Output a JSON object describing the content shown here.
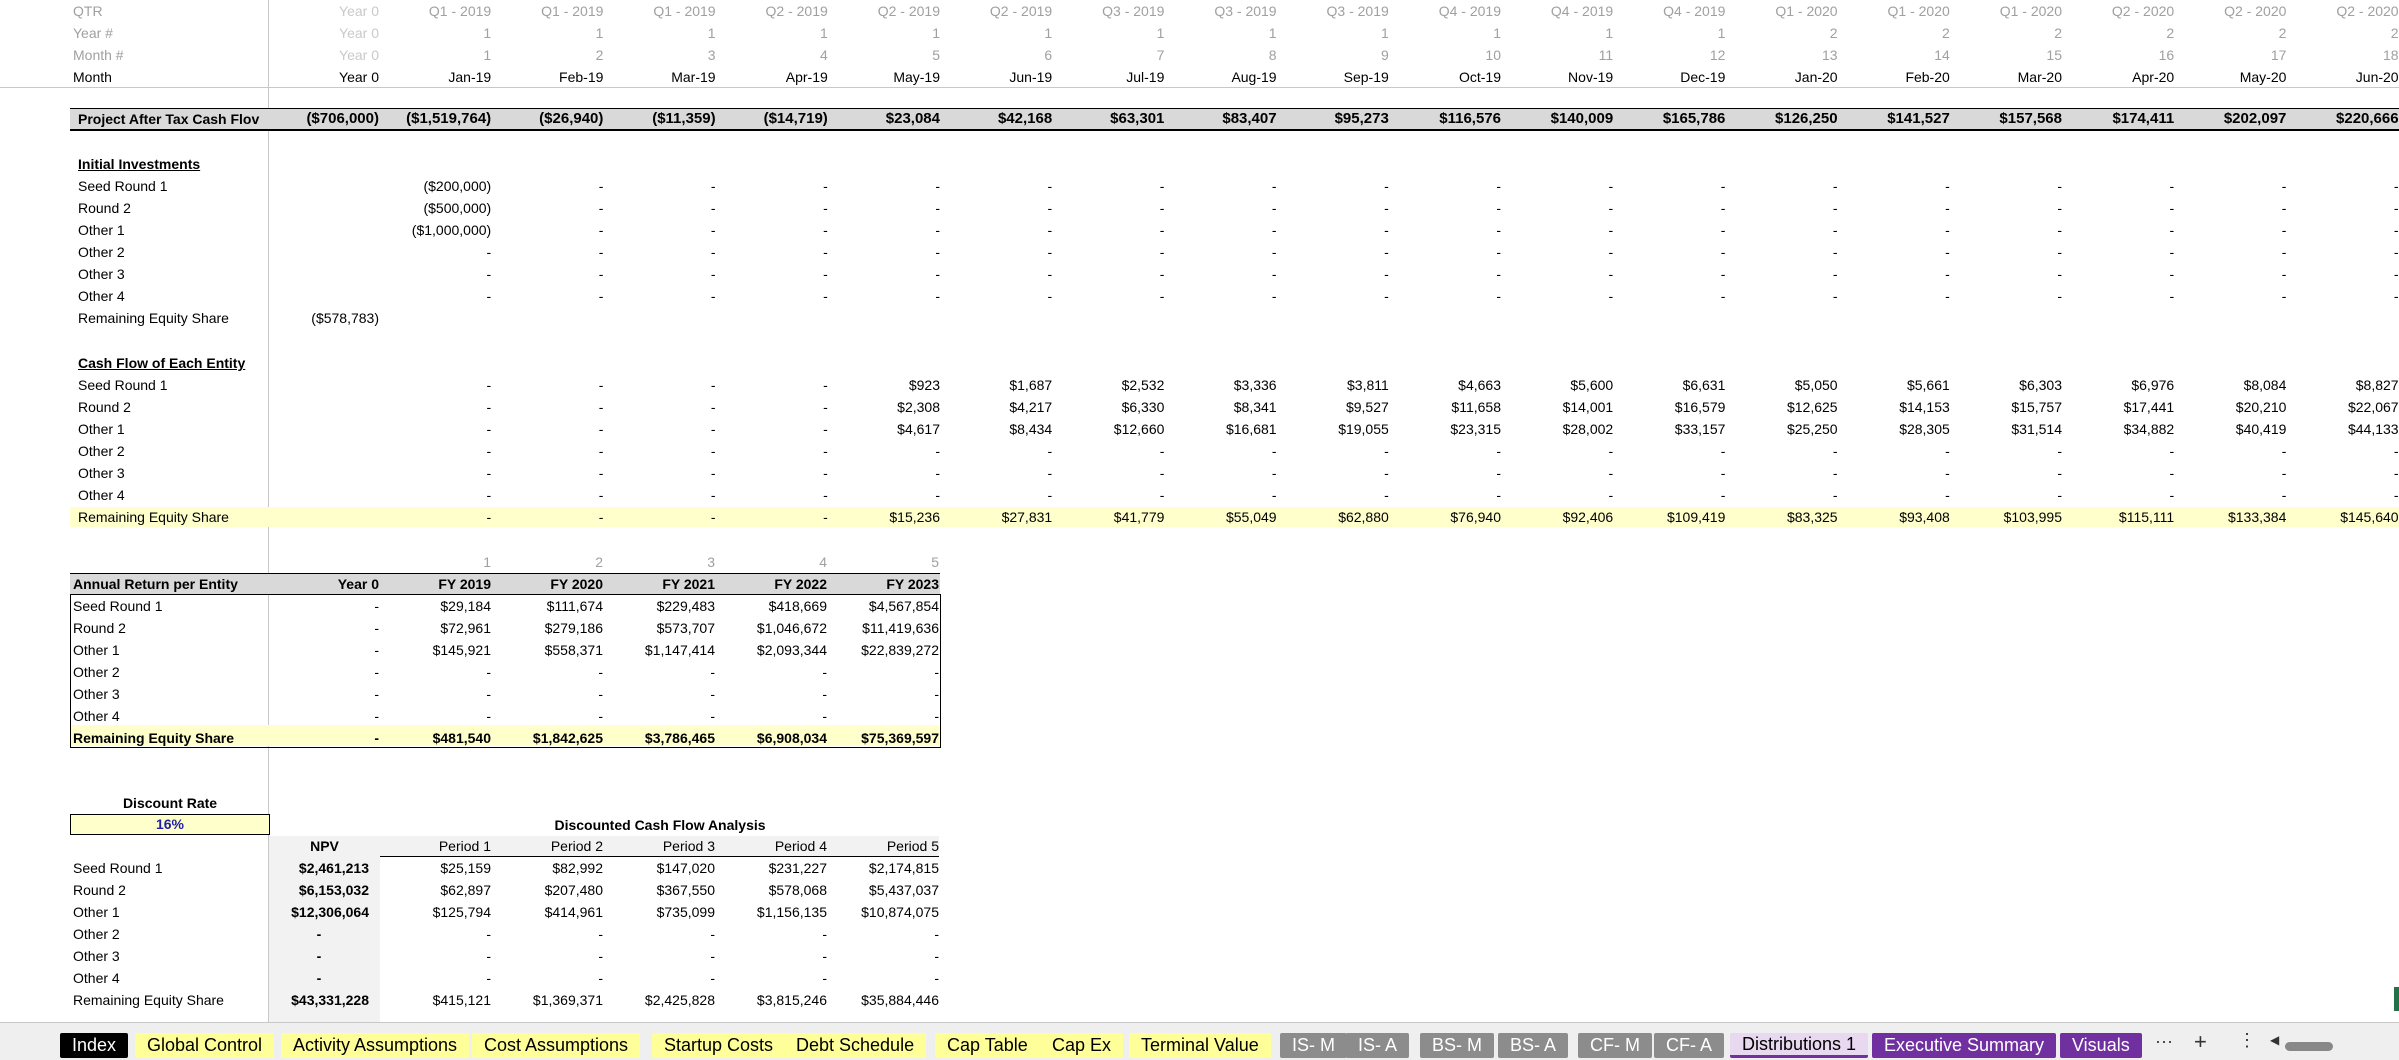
{
  "header_rows": {
    "qtr_label": "QTR",
    "year_label": "Year #",
    "month_num_label": "Month #",
    "month_label": "Month",
    "columns": [
      {
        "qtr": "Year 0",
        "year": "Year 0",
        "mnum": "Year 0",
        "month": "Year 0"
      },
      {
        "qtr": "Q1 - 2019",
        "year": "1",
        "mnum": "1",
        "month": "Jan-19"
      },
      {
        "qtr": "Q1 - 2019",
        "year": "1",
        "mnum": "2",
        "month": "Feb-19"
      },
      {
        "qtr": "Q1 - 2019",
        "year": "1",
        "mnum": "3",
        "month": "Mar-19"
      },
      {
        "qtr": "Q2 - 2019",
        "year": "1",
        "mnum": "4",
        "month": "Apr-19"
      },
      {
        "qtr": "Q2 - 2019",
        "year": "1",
        "mnum": "5",
        "month": "May-19"
      },
      {
        "qtr": "Q2 - 2019",
        "year": "1",
        "mnum": "6",
        "month": "Jun-19"
      },
      {
        "qtr": "Q3 - 2019",
        "year": "1",
        "mnum": "7",
        "month": "Jul-19"
      },
      {
        "qtr": "Q3 - 2019",
        "year": "1",
        "mnum": "8",
        "month": "Aug-19"
      },
      {
        "qtr": "Q3 - 2019",
        "year": "1",
        "mnum": "9",
        "month": "Sep-19"
      },
      {
        "qtr": "Q4 - 2019",
        "year": "1",
        "mnum": "10",
        "month": "Oct-19"
      },
      {
        "qtr": "Q4 - 2019",
        "year": "1",
        "mnum": "11",
        "month": "Nov-19"
      },
      {
        "qtr": "Q4 - 2019",
        "year": "1",
        "mnum": "12",
        "month": "Dec-19"
      },
      {
        "qtr": "Q1 - 2020",
        "year": "2",
        "mnum": "13",
        "month": "Jan-20"
      },
      {
        "qtr": "Q1 - 2020",
        "year": "2",
        "mnum": "14",
        "month": "Feb-20"
      },
      {
        "qtr": "Q1 - 2020",
        "year": "2",
        "mnum": "15",
        "month": "Mar-20"
      },
      {
        "qtr": "Q2 - 2020",
        "year": "2",
        "mnum": "16",
        "month": "Apr-20"
      },
      {
        "qtr": "Q2 - 2020",
        "year": "2",
        "mnum": "17",
        "month": "May-20"
      },
      {
        "qtr": "Q2 - 2020",
        "year": "2",
        "mnum": "18",
        "month": "Jun-20"
      }
    ]
  },
  "project_cash_flow": {
    "label": "Project After Tax Cash Flov",
    "values": [
      "($706,000)",
      "($1,519,764)",
      "($26,940)",
      "($11,359)",
      "($14,719)",
      "$23,084",
      "$42,168",
      "$63,301",
      "$83,407",
      "$95,273",
      "$116,576",
      "$140,009",
      "$165,786",
      "$126,250",
      "$141,527",
      "$157,568",
      "$174,411",
      "$202,097",
      "$220,666"
    ]
  },
  "initial_investments": {
    "title": "Initial Investments",
    "rows": [
      {
        "label": "Seed Round 1",
        "values": [
          "",
          "($200,000)",
          "-",
          "-",
          "-",
          "-",
          "-",
          "-",
          "-",
          "-",
          "-",
          "-",
          "-",
          "-",
          "-",
          "-",
          "-",
          "-",
          "-"
        ]
      },
      {
        "label": "Round 2",
        "values": [
          "",
          "($500,000)",
          "-",
          "-",
          "-",
          "-",
          "-",
          "-",
          "-",
          "-",
          "-",
          "-",
          "-",
          "-",
          "-",
          "-",
          "-",
          "-",
          "-"
        ]
      },
      {
        "label": "Other 1",
        "values": [
          "",
          "($1,000,000)",
          "-",
          "-",
          "-",
          "-",
          "-",
          "-",
          "-",
          "-",
          "-",
          "-",
          "-",
          "-",
          "-",
          "-",
          "-",
          "-",
          "-"
        ]
      },
      {
        "label": "Other 2",
        "values": [
          "",
          "-",
          "-",
          "-",
          "-",
          "-",
          "-",
          "-",
          "-",
          "-",
          "-",
          "-",
          "-",
          "-",
          "-",
          "-",
          "-",
          "-",
          "-"
        ]
      },
      {
        "label": "Other 3",
        "values": [
          "",
          "-",
          "-",
          "-",
          "-",
          "-",
          "-",
          "-",
          "-",
          "-",
          "-",
          "-",
          "-",
          "-",
          "-",
          "-",
          "-",
          "-",
          "-"
        ]
      },
      {
        "label": "Other 4",
        "values": [
          "",
          "-",
          "-",
          "-",
          "-",
          "-",
          "-",
          "-",
          "-",
          "-",
          "-",
          "-",
          "-",
          "-",
          "-",
          "-",
          "-",
          "-",
          "-"
        ]
      },
      {
        "label": "Remaining Equity Share",
        "values": [
          "($578,783)",
          "",
          "",
          "",
          "",
          "",
          "",
          "",
          "",
          "",
          "",
          "",
          "",
          "",
          "",
          "",
          "",
          "",
          ""
        ]
      }
    ]
  },
  "entity_cash_flow": {
    "title": "Cash Flow of Each Entity",
    "rows": [
      {
        "label": "Seed Round 1",
        "values": [
          "",
          "-",
          "-",
          "-",
          "-",
          "$923",
          "$1,687",
          "$2,532",
          "$3,336",
          "$3,811",
          "$4,663",
          "$5,600",
          "$6,631",
          "$5,050",
          "$5,661",
          "$6,303",
          "$6,976",
          "$8,084",
          "$8,827"
        ]
      },
      {
        "label": "Round 2",
        "values": [
          "",
          "-",
          "-",
          "-",
          "-",
          "$2,308",
          "$4,217",
          "$6,330",
          "$8,341",
          "$9,527",
          "$11,658",
          "$14,001",
          "$16,579",
          "$12,625",
          "$14,153",
          "$15,757",
          "$17,441",
          "$20,210",
          "$22,067"
        ]
      },
      {
        "label": "Other 1",
        "values": [
          "",
          "-",
          "-",
          "-",
          "-",
          "$4,617",
          "$8,434",
          "$12,660",
          "$16,681",
          "$19,055",
          "$23,315",
          "$28,002",
          "$33,157",
          "$25,250",
          "$28,305",
          "$31,514",
          "$34,882",
          "$40,419",
          "$44,133"
        ]
      },
      {
        "label": "Other 2",
        "values": [
          "",
          "-",
          "-",
          "-",
          "-",
          "-",
          "-",
          "-",
          "-",
          "-",
          "-",
          "-",
          "-",
          "-",
          "-",
          "-",
          "-",
          "-",
          "-"
        ]
      },
      {
        "label": "Other 3",
        "values": [
          "",
          "-",
          "-",
          "-",
          "-",
          "-",
          "-",
          "-",
          "-",
          "-",
          "-",
          "-",
          "-",
          "-",
          "-",
          "-",
          "-",
          "-",
          "-"
        ]
      },
      {
        "label": "Other 4",
        "values": [
          "",
          "-",
          "-",
          "-",
          "-",
          "-",
          "-",
          "-",
          "-",
          "-",
          "-",
          "-",
          "-",
          "-",
          "-",
          "-",
          "-",
          "-",
          "-"
        ]
      },
      {
        "label": "Remaining Equity Share",
        "values": [
          "",
          "-",
          "-",
          "-",
          "-",
          "$15,236",
          "$27,831",
          "$41,779",
          "$55,049",
          "$62,880",
          "$76,940",
          "$92,406",
          "$109,419",
          "$83,325",
          "$93,408",
          "$103,995",
          "$115,111",
          "$133,384",
          "$145,640"
        ]
      }
    ]
  },
  "annual_return": {
    "year_nums": [
      "1",
      "2",
      "3",
      "4",
      "5"
    ],
    "title": "Annual Return per Entity",
    "headers": [
      "Year 0",
      "FY 2019",
      "FY 2020",
      "FY 2021",
      "FY 2022",
      "FY 2023"
    ],
    "rows": [
      {
        "label": "Seed Round 1",
        "values": [
          "-",
          "$29,184",
          "$111,674",
          "$229,483",
          "$418,669",
          "$4,567,854"
        ]
      },
      {
        "label": "Round 2",
        "values": [
          "-",
          "$72,961",
          "$279,186",
          "$573,707",
          "$1,046,672",
          "$11,419,636"
        ]
      },
      {
        "label": "Other 1",
        "values": [
          "-",
          "$145,921",
          "$558,371",
          "$1,147,414",
          "$2,093,344",
          "$22,839,272"
        ]
      },
      {
        "label": "Other 2",
        "values": [
          "-",
          "-",
          "-",
          "-",
          "-",
          "-"
        ]
      },
      {
        "label": "Other 3",
        "values": [
          "-",
          "-",
          "-",
          "-",
          "-",
          "-"
        ]
      },
      {
        "label": "Other 4",
        "values": [
          "-",
          "-",
          "-",
          "-",
          "-",
          "-"
        ]
      },
      {
        "label": "Remaining Equity Share",
        "values": [
          "-",
          "$481,540",
          "$1,842,625",
          "$3,786,465",
          "$6,908,034",
          "$75,369,597"
        ]
      }
    ]
  },
  "discount": {
    "label": "Discount Rate",
    "value": "16%"
  },
  "dcf": {
    "title": "Discounted Cash Flow Analysis",
    "headers": [
      "NPV",
      "Period 1",
      "Period 2",
      "Period 3",
      "Period 4",
      "Period 5"
    ],
    "rows": [
      {
        "label": "Seed Round 1",
        "values": [
          "$2,461,213",
          "$25,159",
          "$82,992",
          "$147,020",
          "$231,227",
          "$2,174,815"
        ]
      },
      {
        "label": "Round 2",
        "values": [
          "$6,153,032",
          "$62,897",
          "$207,480",
          "$367,550",
          "$578,068",
          "$5,437,037"
        ]
      },
      {
        "label": "Other 1",
        "values": [
          "$12,306,064",
          "$125,794",
          "$414,961",
          "$735,099",
          "$1,156,135",
          "$10,874,075"
        ]
      },
      {
        "label": "Other 2",
        "values": [
          "-",
          "-",
          "-",
          "-",
          "-",
          "-"
        ]
      },
      {
        "label": "Other 3",
        "values": [
          "-",
          "-",
          "-",
          "-",
          "-",
          "-"
        ]
      },
      {
        "label": "Other 4",
        "values": [
          "-",
          "-",
          "-",
          "-",
          "-",
          "-"
        ]
      },
      {
        "label": "Remaining Equity Share",
        "values": [
          "$43,331,228",
          "$415,121",
          "$1,369,371",
          "$2,425,828",
          "$3,815,246",
          "$35,884,446"
        ]
      }
    ]
  },
  "tabs": [
    {
      "label": "Index",
      "bg": "#000000",
      "fg": "#ffffff",
      "active": false
    },
    {
      "label": "Global Control",
      "bg": "#ffff99",
      "fg": "#000000",
      "active": false
    },
    {
      "label": "Activity Assumptions",
      "bg": "#ffff99",
      "fg": "#000000",
      "active": false
    },
    {
      "label": "Cost Assumptions",
      "bg": "#ffff99",
      "fg": "#000000",
      "active": false
    },
    {
      "label": "Startup Costs",
      "bg": "#ffff99",
      "fg": "#000000",
      "active": false
    },
    {
      "label": "Debt Schedule",
      "bg": "#ffff99",
      "fg": "#000000",
      "active": false
    },
    {
      "label": "Cap Table",
      "bg": "#ffff99",
      "fg": "#000000",
      "active": false
    },
    {
      "label": "Cap Ex",
      "bg": "#ffff99",
      "fg": "#000000",
      "active": false
    },
    {
      "label": "Terminal Value",
      "bg": "#ffff99",
      "fg": "#000000",
      "active": false
    },
    {
      "label": "IS- M",
      "bg": "#8c8c8c",
      "fg": "#ffffff",
      "active": false
    },
    {
      "label": "IS- A",
      "bg": "#8c8c8c",
      "fg": "#ffffff",
      "active": false
    },
    {
      "label": "BS- M",
      "bg": "#8c8c8c",
      "fg": "#ffffff",
      "active": false
    },
    {
      "label": "BS- A",
      "bg": "#8c8c8c",
      "fg": "#ffffff",
      "active": false
    },
    {
      "label": "CF- M",
      "bg": "#8c8c8c",
      "fg": "#ffffff",
      "active": false
    },
    {
      "label": "CF- A",
      "bg": "#8c8c8c",
      "fg": "#ffffff",
      "active": false
    },
    {
      "label": "Distributions 1",
      "bg": "#e8d8f0",
      "fg": "#000000",
      "active": true
    },
    {
      "label": "Executive Summary",
      "bg": "#7030a0",
      "fg": "#ffffff",
      "active": false
    },
    {
      "label": "Visuals",
      "bg": "#7030a0",
      "fg": "#ffffff",
      "active": false
    }
  ],
  "tab_controls": {
    "more": "···",
    "add": "+",
    "options": "⋮",
    "scroll_left": "◀"
  }
}
